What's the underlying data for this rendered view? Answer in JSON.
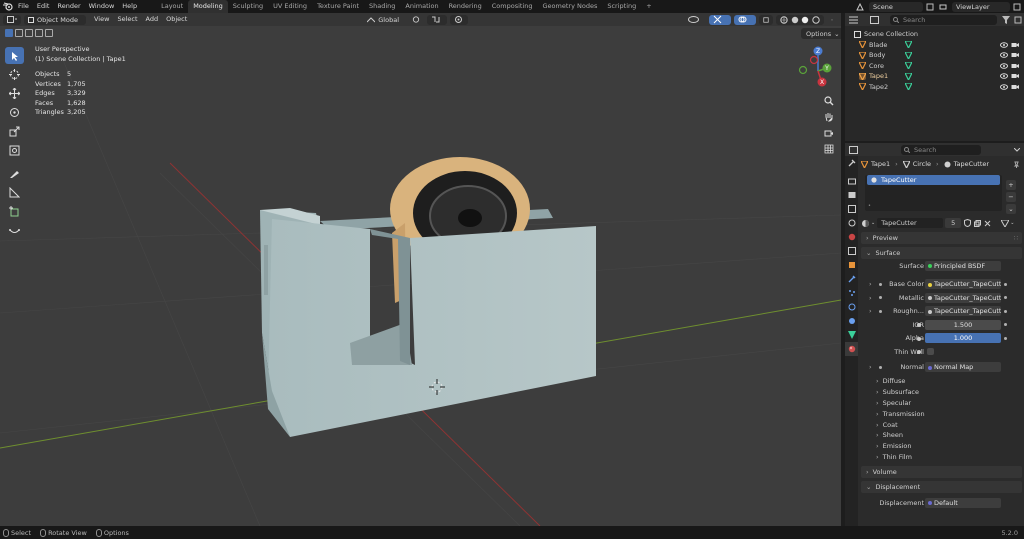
{
  "app": {
    "version": "5.2.0"
  },
  "menus": [
    "File",
    "Edit",
    "Render",
    "Window",
    "Help"
  ],
  "workspaces": [
    {
      "label": "Layout",
      "active": false
    },
    {
      "label": "Modeling",
      "active": true
    },
    {
      "label": "Sculpting",
      "active": false
    },
    {
      "label": "UV Editing",
      "active": false
    },
    {
      "label": "Texture Paint",
      "active": false
    },
    {
      "label": "Shading",
      "active": false
    },
    {
      "label": "Animation",
      "active": false
    },
    {
      "label": "Rendering",
      "active": false
    },
    {
      "label": "Compositing",
      "active": false
    },
    {
      "label": "Geometry Nodes",
      "active": false
    },
    {
      "label": "Scripting",
      "active": false
    }
  ],
  "add_workspace": "+",
  "topright": {
    "scene": "Scene",
    "view_layer": "ViewLayer"
  },
  "viewport": {
    "mode": "Object Mode",
    "menus": [
      "View",
      "Select",
      "Add",
      "Object"
    ],
    "transform_orientation": "Global",
    "options": "Options",
    "title": "User Perspective",
    "collection": "(1) Scene Collection | Tape1",
    "stats": [
      {
        "k": "Objects",
        "v": "5"
      },
      {
        "k": "Vertices",
        "v": "1,705"
      },
      {
        "k": "Edges",
        "v": "3,329"
      },
      {
        "k": "Faces",
        "v": "1,628"
      },
      {
        "k": "Triangles",
        "v": "3,205"
      }
    ],
    "gizmo": {
      "x": "X",
      "y": "Y",
      "z": "Z"
    }
  },
  "outliner": {
    "search_placeholder": "Search",
    "collection": "Scene Collection",
    "objects": [
      "Blade",
      "Body",
      "Core",
      "Tape1",
      "Tape2"
    ]
  },
  "properties": {
    "search_placeholder": "Search",
    "breadcrumb": [
      "Tape1",
      "Circle",
      "TapeCutter"
    ],
    "slots": [
      "TapeCutter"
    ],
    "material": "TapeCutter",
    "users": "5",
    "panels": {
      "preview": "Preview",
      "surface": "Surface",
      "volume": "Volume",
      "displacement": "Displacement"
    },
    "surface": {
      "label": "Surface",
      "value": "Principled BSDF",
      "base_color": {
        "label": "Base Color",
        "value": "TapeCutter_TapeCutt..."
      },
      "metallic": {
        "label": "Metallic",
        "value": "TapeCutter_TapeCutt..."
      },
      "roughness": {
        "label": "Roughn...",
        "value": "TapeCutter_TapeCutt..."
      },
      "ior": {
        "label": "IOR",
        "value": "1.500"
      },
      "alpha": {
        "label": "Alpha",
        "value": "1.000"
      },
      "thin_wall": {
        "label": "Thin Wall"
      },
      "normal": {
        "label": "Normal",
        "value": "Normal Map"
      }
    },
    "subpanels": [
      "Diffuse",
      "Subsurface",
      "Specular",
      "Transmission",
      "Coat",
      "Sheen",
      "Emission",
      "Thin Film"
    ],
    "displacement": {
      "label": "Displacement",
      "value": "Default"
    }
  },
  "statusbar": [
    "Select",
    "Rotate View",
    "Options"
  ],
  "colors": {
    "accent": "#4772b3",
    "header": "#181818",
    "viewport": "#3d3d3d",
    "panel": "#2b2b2b"
  }
}
